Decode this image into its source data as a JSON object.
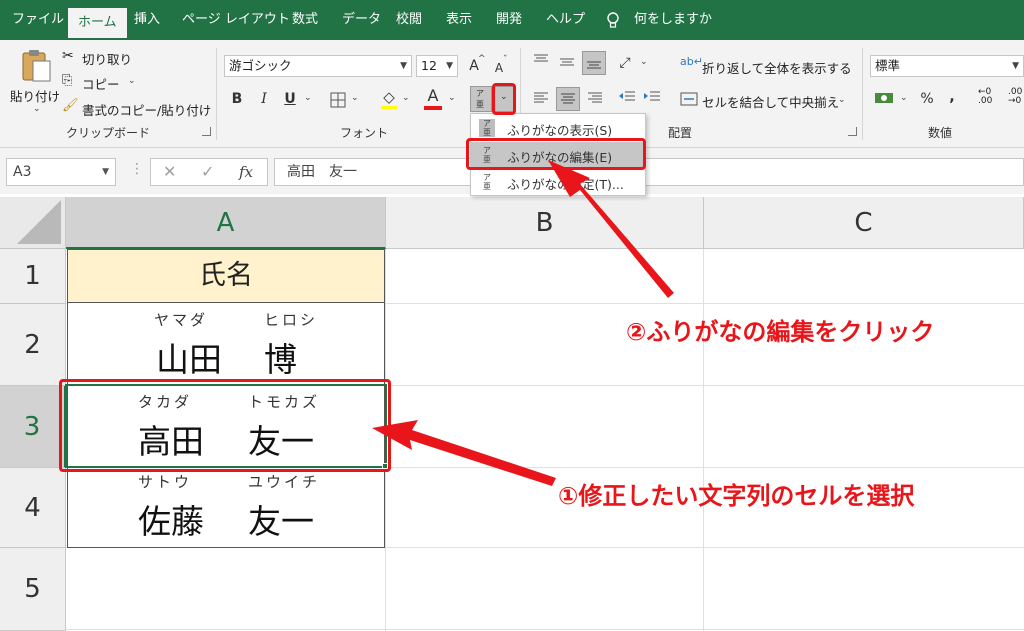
{
  "menu": {
    "tabs": [
      "ファイル",
      "ホーム",
      "挿入",
      "ページ レイアウト",
      "数式",
      "データ",
      "校閲",
      "表示",
      "開発",
      "ヘルプ"
    ],
    "active_tab": "ホーム",
    "tell_me": "何をしますか"
  },
  "ribbon": {
    "clipboard": {
      "paste": "貼り付け",
      "cut": "切り取り",
      "copy": "コピー",
      "format_painter": "書式のコピー/貼り付け",
      "label": "クリップボード"
    },
    "font": {
      "font_name": "游ゴシック",
      "font_size": "12",
      "grow": "A",
      "shrink": "A",
      "bold": "B",
      "italic": "I",
      "underline": "U",
      "font_color_glyph": "A",
      "label": "フォント"
    },
    "alignment": {
      "wrap_text": "折り返して全体を表示する",
      "merge_center": "セルを結合して中央揃え",
      "label": "配置"
    },
    "number": {
      "format": "標準",
      "percent": "%",
      "comma": ",",
      "label": "数値"
    }
  },
  "furigana_menu": {
    "items": [
      "ふりがなの表示(S)",
      "ふりがなの編集(E)",
      "ふりがなの設定(T)..."
    ],
    "highlighted_index": 1
  },
  "formula_bar": {
    "name_box": "A3",
    "fx": "fx",
    "formula": "高田　友一"
  },
  "sheet": {
    "columns": [
      "A",
      "B",
      "C"
    ],
    "rows": [
      "1",
      "2",
      "3",
      "4",
      "5"
    ],
    "selected_column": "A",
    "selected_row": "3",
    "header": "氏名",
    "names": [
      {
        "furi_last": "ヤマダ",
        "furi_first": "ヒロシ",
        "last": "山田",
        "first": "博"
      },
      {
        "furi_last": "タカダ",
        "furi_first": "トモカズ",
        "last": "高田",
        "first": "友一"
      },
      {
        "furi_last": "サトウ",
        "furi_first": "ユウイチ",
        "last": "佐藤",
        "first": "友一"
      }
    ]
  },
  "annotations": {
    "step1": "①修正したい文字列のセルを選択",
    "step2": "②ふりがなの編集をクリック",
    "accent_color": "#e8161a",
    "excel_green": "#217346"
  }
}
